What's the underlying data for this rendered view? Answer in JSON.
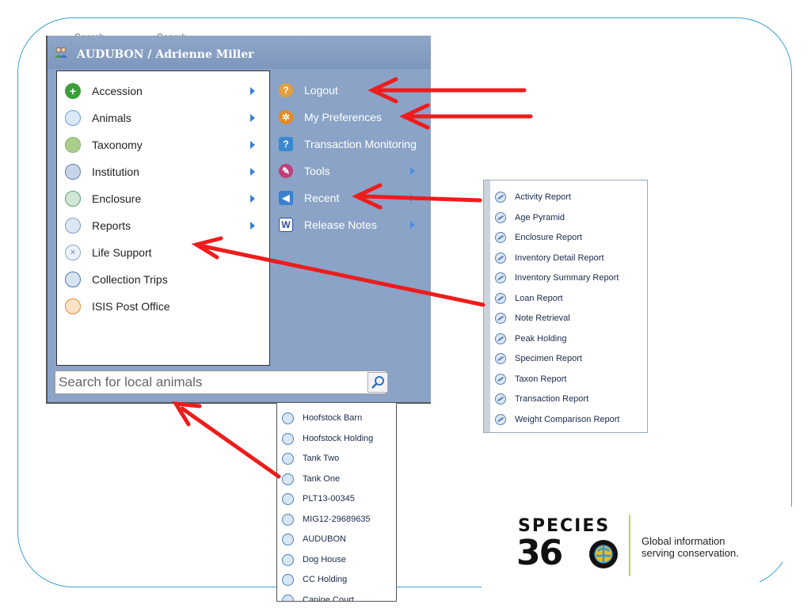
{
  "ghost_labels": [
    "Search",
    "Search"
  ],
  "menu": {
    "title": "AUDUBON / Adrienne Miller",
    "left_items": [
      {
        "label": "Accession",
        "icon": "plus-icon",
        "color": "#3aa03a",
        "arrow": true
      },
      {
        "label": "Animals",
        "icon": "animals-icon",
        "color": "#6b9fd6",
        "arrow": true
      },
      {
        "label": "Taxonomy",
        "icon": "taxonomy-icon",
        "color": "#7fb06a",
        "arrow": true
      },
      {
        "label": "Institution",
        "icon": "globe-icon",
        "color": "#5f7fb3",
        "arrow": true
      },
      {
        "label": "Enclosure",
        "icon": "enclosure-icon",
        "color": "#5aa06a",
        "arrow": true
      },
      {
        "label": "Reports",
        "icon": "reports-icon",
        "color": "#7c9cc7",
        "arrow": true
      },
      {
        "label": "Life Support",
        "icon": "life-support-icon",
        "color": "#8aa5cf",
        "arrow": false
      },
      {
        "label": "Collection Trips",
        "icon": "collection-trips-icon",
        "color": "#4a7ab0",
        "arrow": false
      },
      {
        "label": "ISIS Post Office",
        "icon": "envelope-icon",
        "color": "#e08a3a",
        "arrow": false
      }
    ],
    "right_items": [
      {
        "label": "Logout",
        "icon": "key-icon",
        "color": "#e0a040",
        "arrow": false
      },
      {
        "label": "My Preferences",
        "icon": "gear-icon",
        "color": "#e58a1f",
        "arrow": false
      },
      {
        "label": "Transaction Monitoring",
        "icon": "monitor-icon",
        "color": "#3a88d0",
        "arrow": false
      },
      {
        "label": "Tools",
        "icon": "tools-icon",
        "color": "#c0407a",
        "arrow": true
      },
      {
        "label": "Recent",
        "icon": "back-arrow-icon",
        "color": "#3a7fd0",
        "arrow": true
      },
      {
        "label": "Release Notes",
        "icon": "word-doc-icon",
        "color": "#2b4fa0",
        "arrow": true
      }
    ],
    "search_placeholder": "Search for local animals"
  },
  "reports_menu": [
    "Activity Report",
    "Age Pyramid",
    "Enclosure Report",
    "Inventory Detail Report",
    "Inventory Summary Report",
    "Loan Report",
    "Note Retrieval",
    "Peak Holding",
    "Specimen Report",
    "Taxon Report",
    "Transaction Report",
    "Weight Comparison Report"
  ],
  "recent_menu": [
    "Hoofstock Barn",
    "Hoofstock Holding",
    "Tank Two",
    "Tank One",
    "PLT13-00345",
    "MIG12-29689635",
    "AUDUBON",
    "Dog House",
    "CC Holding",
    "Canine Court"
  ],
  "logo": {
    "word": "SPECIES",
    "number": "36",
    "tagline_1": "Global information",
    "tagline_2": "serving conservation.",
    "divider_color": "#c4d24a"
  },
  "colors": {
    "accent_frame": "#3aa5d6",
    "menu_bg": "#8aa3c6",
    "annotation_arrow": "#ee1c1c"
  }
}
